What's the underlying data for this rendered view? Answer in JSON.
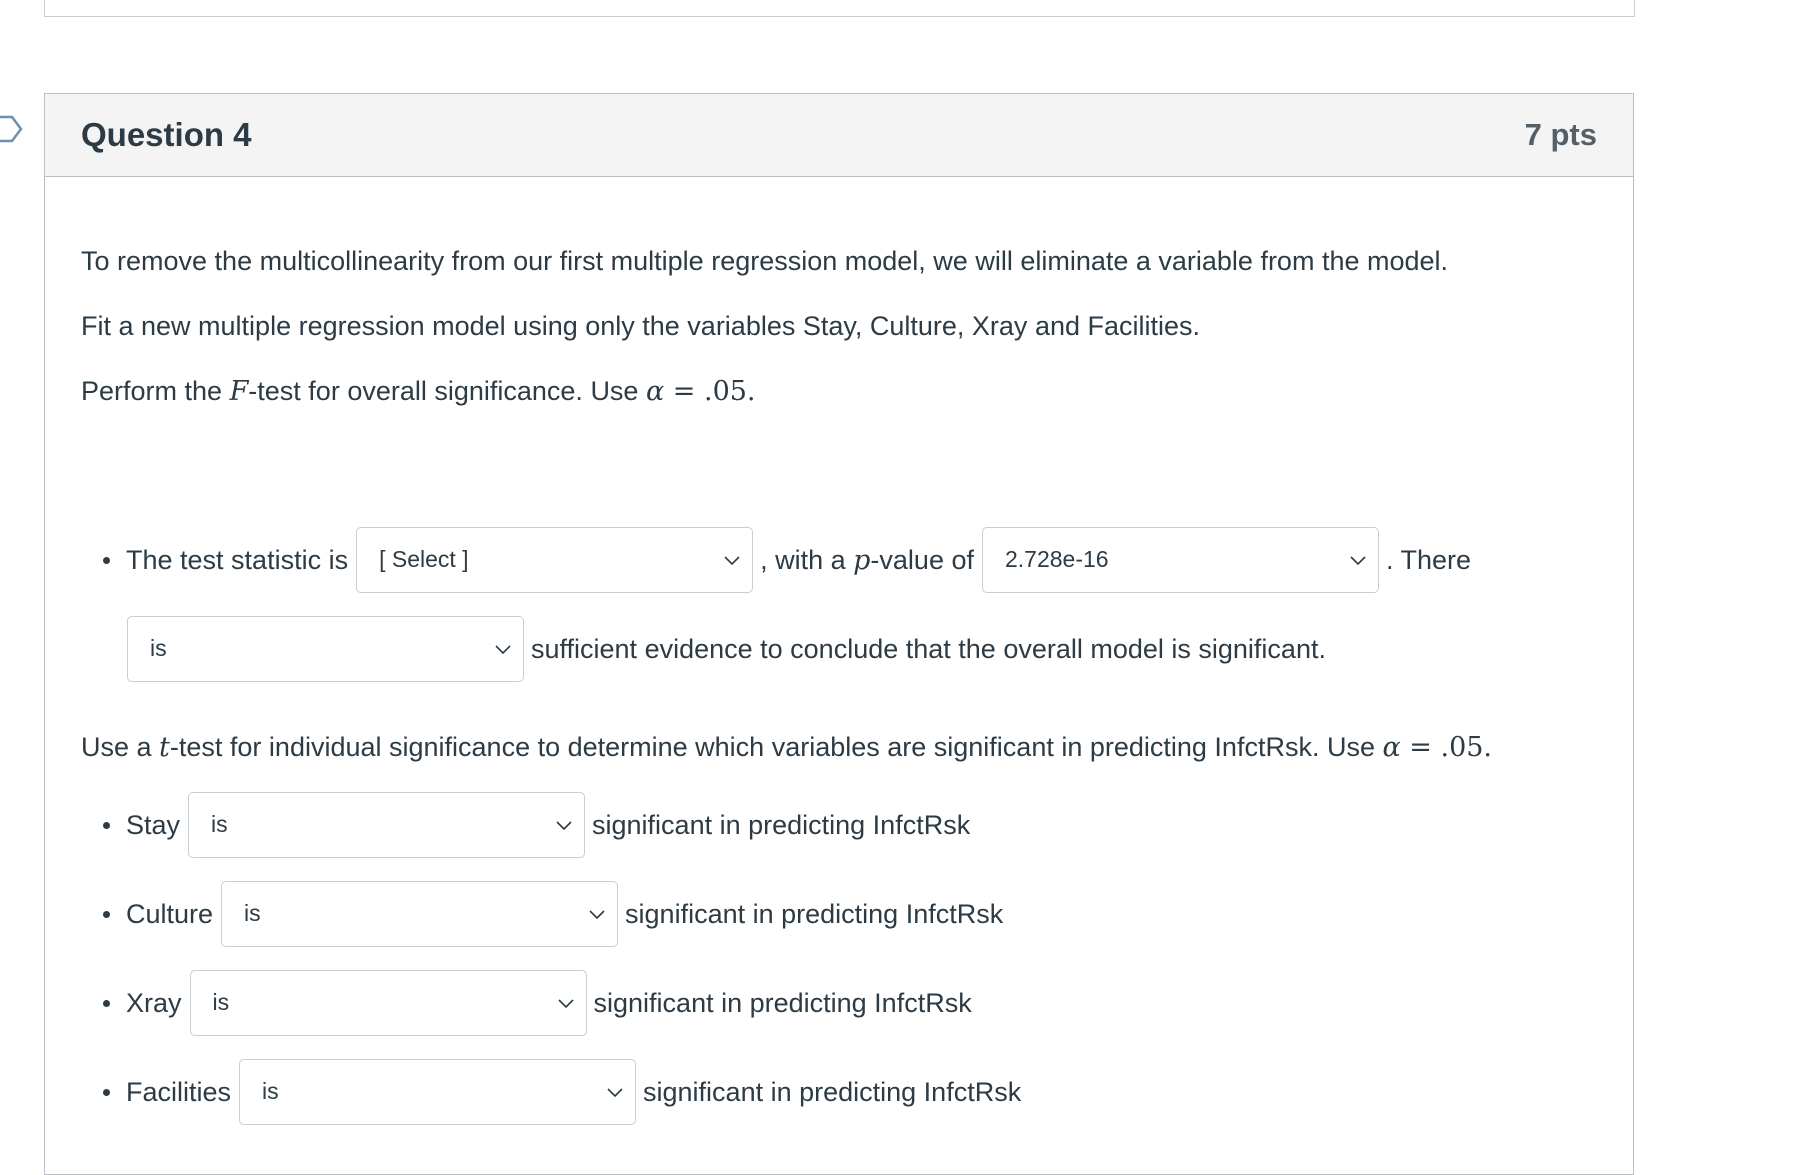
{
  "question": {
    "title": "Question 4",
    "points": "7 pts",
    "paragraphs": {
      "p1": "To remove the multicollinearity from our first multiple regression model, we will eliminate a variable from the model.",
      "p2": "Fit a new multiple regression model using only the variables Stay, Culture, Xray and Facilities.",
      "p3_pre": "Perform the ",
      "p3_var": "F",
      "p3_mid": "-test for overall significance.  Use ",
      "p3_alpha": "α",
      "p3_eq": " = .05.",
      "p4_pre": "Use a ",
      "p4_var": "t",
      "p4_mid": "-test for individual significance to determine which variables are significant in predicting InfctRsk.  Use ",
      "p4_alpha": "α",
      "p4_eq": " = .05."
    },
    "ftest": {
      "stat_label": "The test statistic is",
      "stat_select": "[ Select ]",
      "pval_pre": ", with a ",
      "pval_var": "p",
      "pval_post": "-value of",
      "pval_select": "2.728e-16",
      "there": ".  There",
      "evidence_select": "is",
      "evidence_text": "sufficient evidence to conclude that the overall model is significant."
    },
    "ttests": [
      {
        "variable": "Stay",
        "selected": "is",
        "suffix": "significant in predicting InfctRsk"
      },
      {
        "variable": "Culture",
        "selected": "is",
        "suffix": "significant in predicting InfctRsk"
      },
      {
        "variable": "Xray",
        "selected": "is",
        "suffix": "significant in predicting InfctRsk"
      },
      {
        "variable": "Facilities",
        "selected": "is",
        "suffix": "significant in predicting InfctRsk"
      }
    ]
  },
  "icons": {
    "flag": "flag-outline-icon",
    "chevron": "chevron-down-icon"
  }
}
